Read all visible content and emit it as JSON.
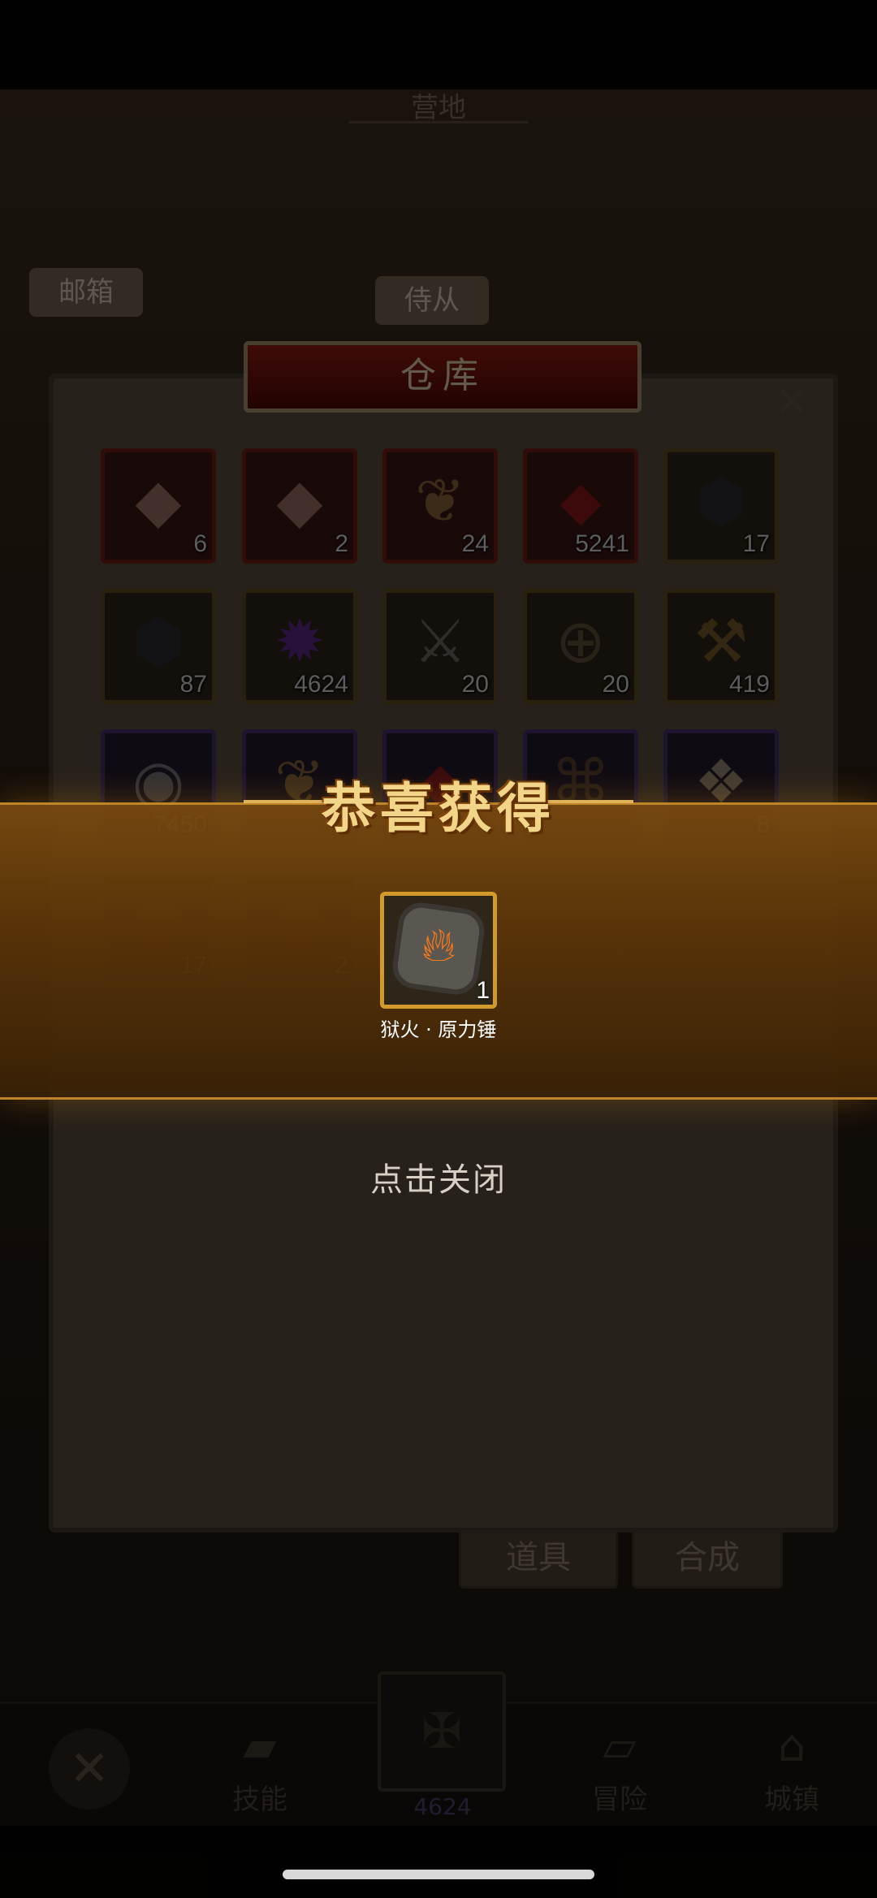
{
  "background": {
    "location_title": "营地",
    "mailbox_label": "邮箱",
    "attendant_label": "侍从",
    "buttons": {
      "items_label": "道具",
      "synthesis_label": "合成"
    },
    "nav": {
      "skills_label": "技能",
      "currency_value": "4624",
      "adventure_label": "冒险",
      "town_label": "城镇"
    }
  },
  "warehouse": {
    "title": "仓库",
    "close_icon": "close-icon",
    "items": [
      {
        "icon": "crystal-badge-icon",
        "quantity": "6",
        "rarity": "red"
      },
      {
        "icon": "crystal-badge-icon",
        "quantity": "2",
        "rarity": "red"
      },
      {
        "icon": "feather-icon",
        "quantity": "24",
        "rarity": "red"
      },
      {
        "icon": "ruby-icon",
        "quantity": "5241",
        "rarity": "red"
      },
      {
        "icon": "lava-ore-icon",
        "quantity": "17",
        "rarity": "gold"
      },
      {
        "icon": "lava-ore-icon",
        "quantity": "87",
        "rarity": "gold"
      },
      {
        "icon": "purple-flame-icon",
        "quantity": "4624",
        "rarity": "gold"
      },
      {
        "icon": "crossed-swords-medal-icon",
        "quantity": "20",
        "rarity": "gold"
      },
      {
        "icon": "compass-icon",
        "quantity": "20",
        "rarity": "gold"
      },
      {
        "icon": "hammer-icon",
        "quantity": "419",
        "rarity": "gold"
      },
      {
        "icon": "eye-rune-icon",
        "quantity": "7450",
        "rarity": "purple"
      },
      {
        "icon": "feather-icon",
        "quantity": "",
        "rarity": "purple"
      },
      {
        "icon": "ruby-icon",
        "quantity": "",
        "rarity": "purple"
      },
      {
        "icon": "scroll-rune-icon",
        "quantity": "",
        "rarity": "purple"
      },
      {
        "icon": "map-scroll-icon",
        "quantity": "8",
        "rarity": "purple"
      },
      {
        "icon": "ore-chunk-icon",
        "quantity": "17",
        "rarity": "gold"
      },
      {
        "icon": "ore-chunk-icon",
        "quantity": "2",
        "rarity": "gold"
      }
    ]
  },
  "reward_popup": {
    "title": "恭喜获得",
    "item": {
      "name": "狱火 · 原力锤",
      "quantity": "1",
      "icon": "hellfire-stone-icon"
    },
    "close_hint": "点击关闭"
  },
  "colors": {
    "banner_gold": "#c98a2a",
    "title_gold": "#f3d58a",
    "rarity_red": "#6a1d16",
    "rarity_gold": "#5a4b22",
    "rarity_purple": "#3f2f64"
  }
}
